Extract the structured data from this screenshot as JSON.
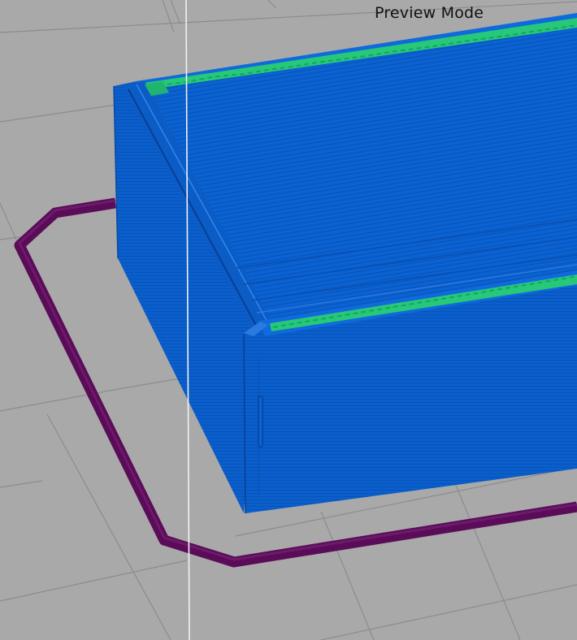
{
  "view": {
    "mode_label": "Preview Mode"
  },
  "colors": {
    "background": "#a9a9a9",
    "grid_line": "#888888",
    "model_fill": "#0a5fcc",
    "model_shadow": "#0549a8",
    "model_highlight": "#2f86ee",
    "infill": "#27c87a",
    "skirt": "#5a0c58",
    "cursor_line": "#f2f2f2"
  },
  "icons": {
    "model": "printed-box-model",
    "skirt": "skirt-outline-path",
    "guide": "vertical-guide-line"
  }
}
